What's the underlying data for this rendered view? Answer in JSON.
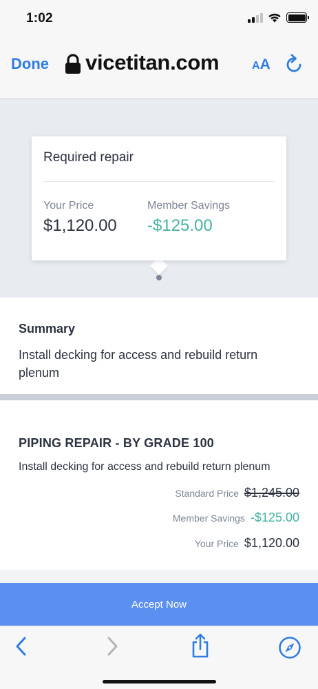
{
  "status_bar": {
    "time": "1:02"
  },
  "browser": {
    "done_label": "Done",
    "url": "vicetitan.com",
    "text_size_small": "A",
    "text_size_large": "A",
    "icons": [
      "lock-icon",
      "reload-icon"
    ]
  },
  "price_card": {
    "title": "Required repair",
    "your_price_label": "Your Price",
    "your_price_value": "$1,120.00",
    "member_savings_label": "Member Savings",
    "member_savings_value": "-$125.00"
  },
  "summary": {
    "heading": "Summary",
    "text": "Install decking for access and rebuild return plenum"
  },
  "item": {
    "title": "PIPING REPAIR - BY GRADE 100",
    "description": "Install decking for access and rebuild return plenum",
    "standard_price_label": "Standard Price",
    "standard_price_value": "$1,245.00",
    "member_savings_label": "Member Savings",
    "member_savings_value": "-$125.00",
    "your_price_label": "Your Price",
    "your_price_value": "$1,120.00"
  },
  "accept_label": "Accept Now",
  "toolbar": {
    "icons": [
      "back-icon",
      "forward-icon",
      "share-icon",
      "compass-icon"
    ]
  },
  "colors": {
    "accent_blue": "#2f7de1",
    "accept_button": "#5b8ff0",
    "savings_green": "#45b3a4",
    "muted_gray": "#7d8696",
    "background_gray": "#e8ebef"
  }
}
